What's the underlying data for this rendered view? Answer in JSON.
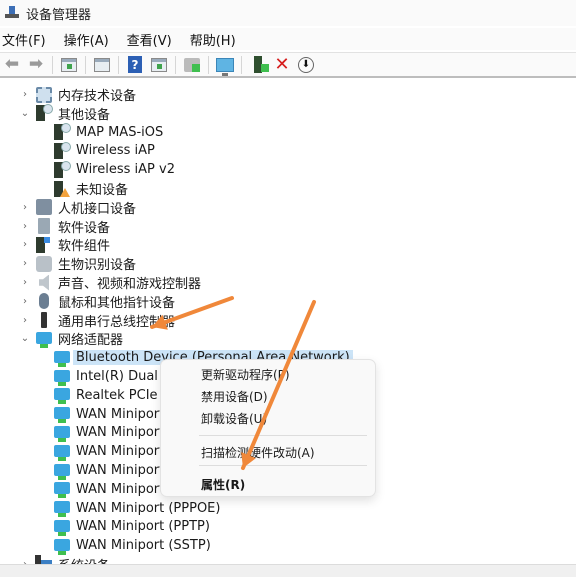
{
  "window": {
    "title": "设备管理器",
    "title_icon": "device-manager-icon"
  },
  "menubar": {
    "items": [
      "文件(F)",
      "操作(A)",
      "查看(V)",
      "帮助(H)"
    ]
  },
  "toolbar": {
    "buttons": [
      {
        "name": "back-button",
        "icon": "arrow-left-icon",
        "glyph": "⬅"
      },
      {
        "name": "forward-button",
        "icon": "arrow-right-icon",
        "glyph": "➡"
      },
      {
        "name": "show-hide-console-tree-button",
        "icon": "console-tree-icon"
      },
      {
        "name": "properties-button",
        "icon": "properties-icon"
      },
      {
        "name": "help-button",
        "icon": "help-icon",
        "glyph": "?"
      },
      {
        "name": "action-pane-button",
        "icon": "action-pane-icon"
      },
      {
        "name": "update-driver-button",
        "icon": "update-driver-icon"
      },
      {
        "name": "scan-hardware-button",
        "icon": "monitor-icon"
      },
      {
        "name": "enable-device-button",
        "icon": "enable-device-icon"
      },
      {
        "name": "uninstall-device-button",
        "icon": "red-x-icon",
        "glyph": "✕"
      },
      {
        "name": "disable-device-button",
        "icon": "down-arrow-circle-icon",
        "glyph": "⬇"
      }
    ]
  },
  "tree": {
    "rows": [
      {
        "level": "category",
        "expanded": false,
        "label": "内存技术设备",
        "icon": "memory-icon"
      },
      {
        "level": "category",
        "expanded": true,
        "label": "其他设备",
        "icon": "other-device-icon"
      },
      {
        "level": "child",
        "label": "MAP MAS-iOS",
        "icon": "other-device-icon"
      },
      {
        "level": "child",
        "label": "Wireless iAP",
        "icon": "other-device-icon"
      },
      {
        "level": "child",
        "label": "Wireless iAP v2",
        "icon": "other-device-icon"
      },
      {
        "level": "child",
        "label": "未知设备",
        "icon": "unknown-device-warning-icon"
      },
      {
        "level": "category",
        "expanded": false,
        "label": "人机接口设备",
        "icon": "hid-icon"
      },
      {
        "level": "category",
        "expanded": false,
        "label": "软件设备",
        "icon": "software-device-icon"
      },
      {
        "level": "category",
        "expanded": false,
        "label": "软件组件",
        "icon": "software-component-icon"
      },
      {
        "level": "category",
        "expanded": false,
        "label": "生物识别设备",
        "icon": "biometric-icon"
      },
      {
        "level": "category",
        "expanded": false,
        "label": "声音、视频和游戏控制器",
        "icon": "audio-icon"
      },
      {
        "level": "category",
        "expanded": false,
        "label": "鼠标和其他指针设备",
        "icon": "mouse-icon"
      },
      {
        "level": "category",
        "expanded": false,
        "label": "通用串行总线控制器",
        "icon": "usb-icon"
      },
      {
        "level": "category",
        "expanded": true,
        "label": "网络适配器",
        "icon": "network-adapter-icon"
      },
      {
        "level": "child",
        "label": "Bluetooth Device (Personal Area Network)",
        "icon": "network-adapter-icon",
        "selected": true
      },
      {
        "level": "child",
        "label": "Intel(R) Dual B",
        "icon": "network-adapter-icon"
      },
      {
        "level": "child",
        "label": "Realtek PCIe G",
        "icon": "network-adapter-icon"
      },
      {
        "level": "child",
        "label": "WAN Miniport",
        "icon": "network-adapter-icon"
      },
      {
        "level": "child",
        "label": "WAN Miniport",
        "icon": "network-adapter-icon"
      },
      {
        "level": "child",
        "label": "WAN Miniport",
        "icon": "network-adapter-icon"
      },
      {
        "level": "child",
        "label": "WAN Miniport",
        "icon": "network-adapter-icon"
      },
      {
        "level": "child",
        "label": "WAN Miniport",
        "icon": "network-adapter-icon"
      },
      {
        "level": "child",
        "label": "WAN Miniport (PPPOE)",
        "icon": "network-adapter-icon"
      },
      {
        "level": "child",
        "label": "WAN Miniport (PPTP)",
        "icon": "network-adapter-icon"
      },
      {
        "level": "child",
        "label": "WAN Miniport (SSTP)",
        "icon": "network-adapter-icon"
      },
      {
        "level": "category",
        "expanded": false,
        "label": "系统设备",
        "icon": "system-device-icon"
      }
    ]
  },
  "context_menu": {
    "items": [
      {
        "label": "更新驱动程序(P)",
        "bold": false
      },
      {
        "label": "禁用设备(D)",
        "bold": false
      },
      {
        "label": "卸载设备(U)",
        "bold": false
      },
      {
        "separator": true
      },
      {
        "label": "扫描检测硬件改动(A)",
        "bold": false
      },
      {
        "separator": true
      },
      {
        "label": "属性(R)",
        "bold": true
      }
    ]
  },
  "annotations": {
    "arrow_color": "#f0883a",
    "arrows": [
      "points-to-network-adapters",
      "points-to-properties"
    ]
  },
  "colors": {
    "selection": "#cce4f7",
    "accent": "#3aa6e0"
  }
}
